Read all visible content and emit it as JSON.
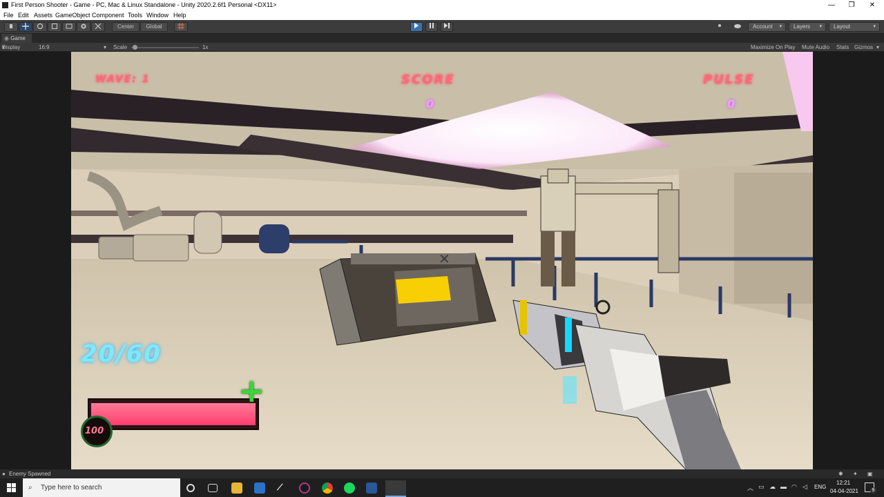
{
  "window": {
    "title": "First Person Shooter - Game - PC, Mac & Linux Standalone - Unity 2020.2.6f1 Personal <DX11>",
    "minimize": "—",
    "maximize": "❐",
    "close": "✕"
  },
  "menu": [
    "File",
    "Edit",
    "Assets",
    "GameObject",
    "Component",
    "Tools",
    "Window",
    "Help"
  ],
  "toolbar": {
    "pivot_label": "Center",
    "space_label": "Global",
    "account_label": "Account",
    "layers_label": "Layers",
    "layout_label": "Layout",
    "caret": "▾"
  },
  "game_view": {
    "tab_label": "Game",
    "display_label": "Display 1",
    "aspect_label": "16:9 Aspect",
    "scale_label": "Scale",
    "scale_value": "1x",
    "scale_fraction": 0.02,
    "maximize_label": "Maximize On Play",
    "mute_label": "Mute Audio",
    "stats_label": "Stats",
    "gizmos_label": "Gizmos"
  },
  "hud": {
    "wave_text": "WAVE: 1",
    "score_label": "SCORE",
    "score_value": "0",
    "pulse_label": "PULSE",
    "pulse_value": "0",
    "ammo_text": "20/60",
    "health_value": "100",
    "health_fraction": 1.0,
    "plus_symbol": "+",
    "crosshair_symbol": "✕"
  },
  "status_message": "Enemy Spawned",
  "taskbar": {
    "search_placeholder": "Type here to search",
    "language": "ENG",
    "time": "12:21",
    "date": "04-04-2021",
    "notification_count": "9"
  },
  "colors": {
    "hud_pink": "#ff6a7a",
    "hud_cyan": "#6ee6ff",
    "health_fill": "#ff3d6e",
    "plus_green": "#3cd43c",
    "unity_play": "#3a72b0"
  }
}
